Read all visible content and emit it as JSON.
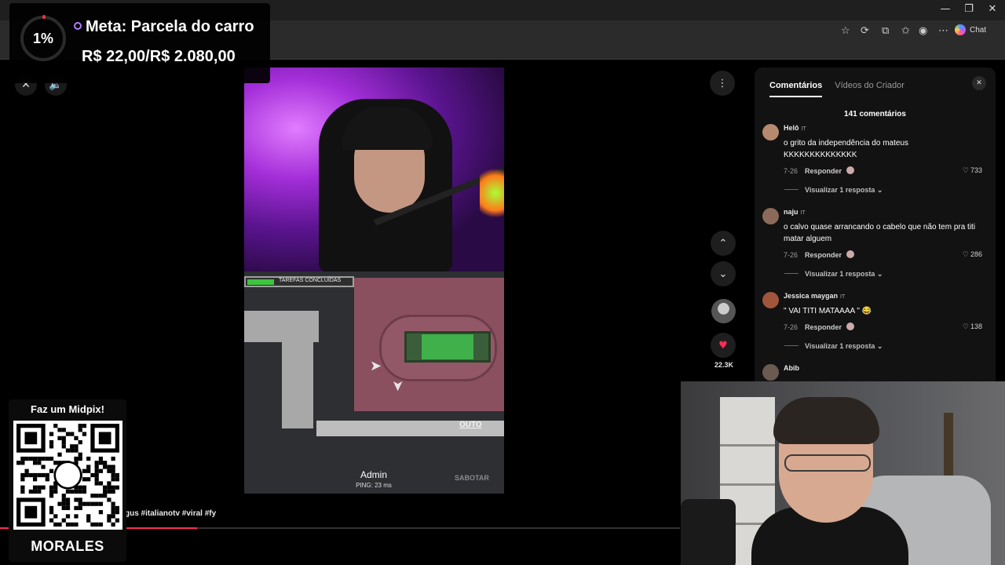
{
  "browser": {
    "window_controls": [
      "—",
      "❐",
      "✕"
    ],
    "chat_label": "Chat"
  },
  "goal": {
    "percent": "1%",
    "title": "Meta: Parcela do carro",
    "amount": "R$ 22,00/R$ 2.080,00"
  },
  "video": {
    "task_label": "TAREFAS CONCLUÍDAS",
    "player_name": "Admin",
    "ping": "PING: 23 ms",
    "action_button": "OUTO",
    "sabotage_label": "SABOTAR"
  },
  "rail": {
    "like_count": "22.3K",
    "icons": [
      "more-icon",
      "chevron-up-icon",
      "chevron-down-icon",
      "heart-icon"
    ]
  },
  "comments": {
    "tabs": [
      {
        "label": "Comentários",
        "active": true
      },
      {
        "label": "Vídeos do Criador",
        "active": false
      }
    ],
    "count_label": "141 comentários",
    "reply_label": "Responder",
    "items": [
      {
        "user": "Helô",
        "tag": "IT",
        "text": "o grito da independência do mateus KKKKKKKKKKKKKK",
        "date": "7-26",
        "likes": "733",
        "view_replies": "Visualizar 1 resposta",
        "avatar_color": "#b58a6e"
      },
      {
        "user": "naju",
        "tag": "IT",
        "text": "o calvo quase arrancando o cabelo que não tem pra titi matar alguem",
        "date": "7-26",
        "likes": "286",
        "view_replies": "Visualizar 1 resposta",
        "avatar_color": "#8c6a5a"
      },
      {
        "user": "Jessica maygan",
        "tag": "IT",
        "text": "\" VAI TITI MATAAAA \" 😂",
        "date": "7-26",
        "likes": "138",
        "view_replies": "Visualizar 1 resposta",
        "avatar_color": "#a0553c"
      },
      {
        "user": "Abib",
        "tag": "",
        "text": "",
        "date": "",
        "likes": "",
        "view_replies": "",
        "avatar_color": "#6b5a52"
      }
    ]
  },
  "qr": {
    "title": "Faz um Midpix!",
    "name": "MORALES"
  },
  "caption": "gus #italianotv #viral #fy",
  "progress_fraction": 0.29
}
